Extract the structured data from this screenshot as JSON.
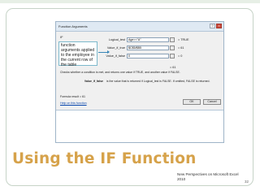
{
  "slide": {
    "title": "Using the IF Function",
    "footer_line1": "New Perspectives on Microsoft Excel",
    "footer_line2": "2010",
    "page_number": "32"
  },
  "dialog": {
    "window_title": "Function Arguments",
    "function_name": "IF",
    "arguments": [
      {
        "label": "Logical_test",
        "value": "Age>=\"A\"",
        "result": "= TRUE"
      },
      {
        "label": "Value_if_true",
        "value": "$C$5/$B5",
        "result": "= 61"
      },
      {
        "label": "Value_if_false",
        "value": "0",
        "result": "= 0"
      }
    ],
    "result_line": "= 61",
    "description": "Checks whether a condition is met, and returns one value if TRUE, and another value if FALSE.",
    "argument_name": "Value_if_false",
    "argument_help": "is the value that is returned if Logical_test is FALSE. If omitted, FALSE is returned.",
    "formula_result": "Formula result = 61",
    "help_link": "Help on this function",
    "ok_label": "OK",
    "cancel_label": "Cancel"
  },
  "callout": {
    "text": "function arguments applied to the employee in the current row of the table"
  },
  "colors": {
    "title": "#d6a24a",
    "frame": "#c6d3c7",
    "callout_border": "#7db9cc"
  },
  "icons": {
    "minimize": "minimize-icon",
    "close": "close-icon",
    "range-picker": "range-picker-icon"
  }
}
